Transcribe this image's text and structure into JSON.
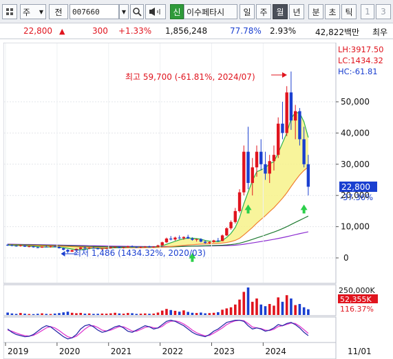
{
  "toolbar": {
    "market_label": "주",
    "period_label": "전",
    "code_value": "007660",
    "badge_new": "신",
    "stock_name": "이수페타시",
    "periods": [
      "일",
      "주",
      "월",
      "년"
    ],
    "selected_period": "월",
    "intraday": [
      "분",
      "초",
      "틱"
    ],
    "counts": [
      "1",
      "3"
    ]
  },
  "quote": {
    "price": "22,800",
    "direction_icon": "up-triangle-icon",
    "change": "300",
    "change_pct": "+1.33%",
    "volume": "1,856,248",
    "volume_ratio": "77.78%",
    "turnover": "2.93%",
    "market_cap": "42,822백만",
    "extra": "최우"
  },
  "indicators": {
    "lh": "LH:3917.50",
    "lc": "LC:1434.32",
    "hc": "HC:-61.81"
  },
  "annotations": {
    "high": "최고 59,700 (-61.81%, 2024/07)",
    "low": "최저 1,486 (1434.32%, 2020/03)"
  },
  "price_axis": {
    "ticks": [
      "50,000",
      "40,000",
      "30,000",
      "20,000",
      "10,000",
      "0"
    ],
    "current_price": "22,800",
    "current_pct": "-37.36%"
  },
  "volume_axis": {
    "max": "250,000K",
    "current": "52,355K",
    "current_pct": "116.37%"
  },
  "x_axis": {
    "labels": [
      "2019",
      "2020",
      "2021",
      "2022",
      "2023",
      "2024"
    ],
    "right_label": "11/01"
  },
  "colors": {
    "up": "#e0141e",
    "down": "#1a3fd0",
    "ma_fill": "#f7f28a",
    "ma_orange": "#f08030",
    "ma_green": "#2cb34a",
    "ma_darkgreen": "#1e7a30",
    "ma_purple": "#8a2ad0",
    "signal": "#2ccf4a"
  },
  "chart_data": {
    "type": "candlestick",
    "period": "monthly",
    "x_start": "2019-01",
    "price_max_label": 59700,
    "price_min_label": 1486,
    "volume_series_name": "",
    "ylim": [
      0,
      60000
    ],
    "candles": [
      [
        4200,
        4500,
        3800,
        4100
      ],
      [
        4100,
        4300,
        3700,
        3900
      ],
      [
        3900,
        4100,
        3600,
        3800
      ],
      [
        3800,
        4200,
        3600,
        4000
      ],
      [
        4000,
        4100,
        3500,
        3600
      ],
      [
        3600,
        3900,
        3400,
        3700
      ],
      [
        3700,
        3800,
        3300,
        3400
      ],
      [
        3400,
        3600,
        3100,
        3300
      ],
      [
        3300,
        3700,
        3200,
        3600
      ],
      [
        3600,
        3900,
        3400,
        3500
      ],
      [
        3500,
        3800,
        3300,
        3700
      ],
      [
        3700,
        3900,
        3400,
        3500
      ],
      [
        3500,
        3700,
        3000,
        3100
      ],
      [
        3100,
        3300,
        2400,
        2600
      ],
      [
        2600,
        2800,
        1486,
        2000
      ],
      [
        2000,
        2600,
        1900,
        2500
      ],
      [
        2500,
        3000,
        2400,
        2900
      ],
      [
        2900,
        3500,
        2700,
        3300
      ],
      [
        3300,
        3600,
        2900,
        3000
      ],
      [
        3000,
        3400,
        2800,
        3200
      ],
      [
        3200,
        3500,
        3000,
        3100
      ],
      [
        3100,
        3300,
        2700,
        2800
      ],
      [
        2800,
        3100,
        2600,
        3000
      ],
      [
        3000,
        3300,
        2900,
        3100
      ],
      [
        3100,
        3600,
        3000,
        3400
      ],
      [
        3400,
        3800,
        3200,
        3500
      ],
      [
        3500,
        3700,
        3100,
        3200
      ],
      [
        3200,
        3500,
        3000,
        3400
      ],
      [
        3400,
        3900,
        3300,
        3700
      ],
      [
        3700,
        4000,
        3400,
        3500
      ],
      [
        3500,
        3700,
        3200,
        3300
      ],
      [
        3300,
        3600,
        3100,
        3500
      ],
      [
        3500,
        3800,
        3300,
        3600
      ],
      [
        3600,
        3900,
        3300,
        3400
      ],
      [
        3400,
        3700,
        3200,
        3600
      ],
      [
        3600,
        4200,
        3500,
        4000
      ],
      [
        4000,
        5200,
        3900,
        5000
      ],
      [
        5000,
        6500,
        4800,
        6200
      ],
      [
        6200,
        7000,
        5600,
        5900
      ],
      [
        5900,
        6800,
        5500,
        6500
      ],
      [
        6500,
        7200,
        6000,
        6300
      ],
      [
        6300,
        6900,
        5800,
        6700
      ],
      [
        6700,
        7400,
        6100,
        6200
      ],
      [
        6200,
        6600,
        5500,
        5800
      ],
      [
        5800,
        6200,
        5200,
        6000
      ],
      [
        6000,
        6300,
        5000,
        5200
      ],
      [
        5200,
        5600,
        4500,
        4800
      ],
      [
        4800,
        5300,
        4400,
        5100
      ],
      [
        5100,
        5800,
        4900,
        5600
      ],
      [
        5600,
        6400,
        5200,
        5400
      ],
      [
        5400,
        7500,
        5300,
        7200
      ],
      [
        7200,
        9800,
        7000,
        9500
      ],
      [
        9500,
        12000,
        9000,
        11500
      ],
      [
        11500,
        16000,
        11000,
        15000
      ],
      [
        15000,
        22000,
        14500,
        21000
      ],
      [
        21000,
        36000,
        20000,
        34000
      ],
      [
        34000,
        42000,
        22000,
        24000
      ],
      [
        24000,
        32000,
        20000,
        29000
      ],
      [
        29000,
        36000,
        26000,
        34000
      ],
      [
        34000,
        38000,
        28000,
        30000
      ],
      [
        30000,
        34000,
        25000,
        27000
      ],
      [
        27000,
        33000,
        24000,
        31000
      ],
      [
        31000,
        36000,
        28000,
        33000
      ],
      [
        33000,
        45000,
        32000,
        43000
      ],
      [
        43000,
        50000,
        38000,
        40000
      ],
      [
        40000,
        55000,
        39000,
        53000
      ],
      [
        53000,
        59700,
        41000,
        44000
      ],
      [
        44000,
        49000,
        38000,
        47000
      ],
      [
        47000,
        48000,
        36000,
        38000
      ],
      [
        38000,
        42000,
        29000,
        30000
      ],
      [
        30000,
        33000,
        20000,
        22800
      ]
    ],
    "volume_k": [
      22,
      14,
      10,
      18,
      12,
      9,
      8,
      11,
      15,
      10,
      9,
      13,
      17,
      24,
      30,
      20,
      16,
      19,
      12,
      14,
      10,
      11,
      13,
      12,
      15,
      20,
      14,
      12,
      18,
      16,
      10,
      12,
      14,
      11,
      13,
      22,
      40,
      55,
      45,
      38,
      30,
      42,
      28,
      20,
      18,
      22,
      15,
      17,
      20,
      25,
      48,
      60,
      70,
      95,
      140,
      210,
      250,
      120,
      150,
      95,
      80,
      100,
      85,
      160,
      120,
      180,
      150,
      90,
      100,
      70,
      52
    ],
    "ma": {
      "ma5": [
        4100,
        4000,
        3950,
        3950,
        3880,
        3800,
        3720,
        3600,
        3500,
        3500,
        3500,
        3520,
        3440,
        3300,
        3080,
        2840,
        2620,
        2600,
        2740,
        2980,
        3100,
        3080,
        3020,
        3040,
        3140,
        3240,
        3280,
        3320,
        3440,
        3460,
        3480,
        3480,
        3520,
        3500,
        3480,
        3620,
        3900,
        4360,
        4860,
        5320,
        5780,
        6120,
        6320,
        6340,
        6200,
        6000,
        5600,
        5380,
        5340,
        5180,
        5620,
        6540,
        7840,
        9740,
        12840,
        17320,
        21120,
        24700,
        27600,
        28200,
        28800,
        30200,
        30800,
        33600,
        36800,
        40000,
        44600,
        46600,
        46400,
        43600,
        38560
      ],
      "ma20": [
        4200,
        4150,
        4100,
        4080,
        4050,
        4000,
        3970,
        3930,
        3900,
        3870,
        3840,
        3810,
        3780,
        3740,
        3680,
        3620,
        3570,
        3520,
        3480,
        3440,
        3400,
        3360,
        3320,
        3280,
        3260,
        3250,
        3240,
        3230,
        3230,
        3240,
        3250,
        3260,
        3280,
        3300,
        3320,
        3360,
        3420,
        3520,
        3640,
        3760,
        3890,
        4010,
        4130,
        4230,
        4320,
        4400,
        4460,
        4520,
        4590,
        4660,
        4760,
        4940,
        5220,
        5620,
        6280,
        7360,
        8540,
        9760,
        11100,
        12320,
        13500,
        14820,
        16060,
        17560,
        19100,
        20840,
        22850,
        24780,
        26560,
        28000,
        29100
      ],
      "ma40": [
        4300,
        4280,
        4250,
        4220,
        4190,
        4160,
        4130,
        4100,
        4070,
        4040,
        4010,
        3980,
        3950,
        3920,
        3880,
        3840,
        3800,
        3760,
        3730,
        3700,
        3670,
        3640,
        3610,
        3590,
        3570,
        3550,
        3530,
        3510,
        3500,
        3490,
        3480,
        3470,
        3460,
        3450,
        3440,
        3440,
        3450,
        3480,
        3520,
        3570,
        3620,
        3680,
        3730,
        3770,
        3810,
        3850,
        3890,
        3930,
        3960,
        4000,
        4060,
        4150,
        4280,
        4450,
        4700,
        5080,
        5500,
        5930,
        6400,
        6850,
        7300,
        7800,
        8270,
        8800,
        9380,
        10000,
        10700,
        11380,
        12050,
        12720,
        13400
      ],
      "ma60": [
        4400,
        4380,
        4360,
        4340,
        4310,
        4290,
        4260,
        4240,
        4210,
        4190,
        4160,
        4140,
        4110,
        4080,
        4050,
        4020,
        3990,
        3960,
        3930,
        3900,
        3880,
        3850,
        3830,
        3800,
        3780,
        3760,
        3740,
        3720,
        3700,
        3690,
        3670,
        3660,
        3650,
        3640,
        3630,
        3620,
        3620,
        3630,
        3650,
        3670,
        3690,
        3710,
        3740,
        3760,
        3780,
        3800,
        3810,
        3830,
        3850,
        3870,
        3900,
        3940,
        4000,
        4080,
        4200,
        4380,
        4580,
        4800,
        5020,
        5250,
        5480,
        5720,
        5960,
        6220,
        6500,
        6800,
        7120,
        7440,
        7760,
        8060,
        8350
      ]
    },
    "stochastic": [
      55,
      40,
      30,
      25,
      20,
      22,
      30,
      45,
      60,
      70,
      65,
      50,
      35,
      20,
      10,
      15,
      30,
      55,
      70,
      75,
      65,
      50,
      40,
      45,
      55,
      65,
      70,
      60,
      45,
      40,
      50,
      60,
      70,
      65,
      55,
      60,
      75,
      90,
      95,
      90,
      80,
      70,
      55,
      40,
      30,
      25,
      20,
      30,
      45,
      55,
      70,
      85,
      90,
      95,
      95,
      90,
      70,
      55,
      60,
      55,
      45,
      50,
      60,
      75,
      70,
      80,
      85,
      75,
      60,
      40,
      25
    ],
    "stochastic_signal": [
      50,
      45,
      37,
      30,
      25,
      23,
      26,
      36,
      48,
      60,
      66,
      60,
      48,
      33,
      20,
      15,
      22,
      38,
      55,
      68,
      70,
      62,
      50,
      46,
      50,
      58,
      66,
      65,
      56,
      46,
      45,
      53,
      62,
      66,
      61,
      59,
      67,
      82,
      90,
      92,
      87,
      78,
      65,
      50,
      38,
      30,
      24,
      26,
      36,
      48,
      60,
      75,
      85,
      92,
      95,
      93,
      80,
      64,
      60,
      57,
      50,
      48,
      54,
      66,
      70,
      76,
      82,
      80,
      68,
      52,
      35
    ]
  }
}
